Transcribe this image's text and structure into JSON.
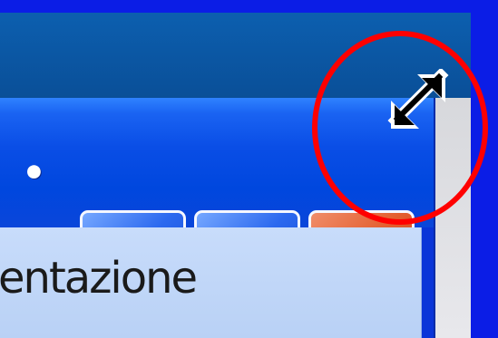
{
  "window": {
    "title_fragment": "•",
    "content_text_fragment": "entazione",
    "caption_buttons": {
      "minimize_icon": "minimize-icon",
      "maximize_icon": "maximize-icon",
      "close_icon": "close-icon"
    }
  },
  "overlay": {
    "highlight": "red-annotation-circle",
    "cursor": "diagonal-resize-cursor"
  },
  "colors": {
    "desktop_blue": "#0b1de6",
    "title_blue": "#0047de",
    "content_light_blue": "#c8dcfb",
    "close_red": "#d64b1f",
    "annotation_red": "#ff0000"
  }
}
